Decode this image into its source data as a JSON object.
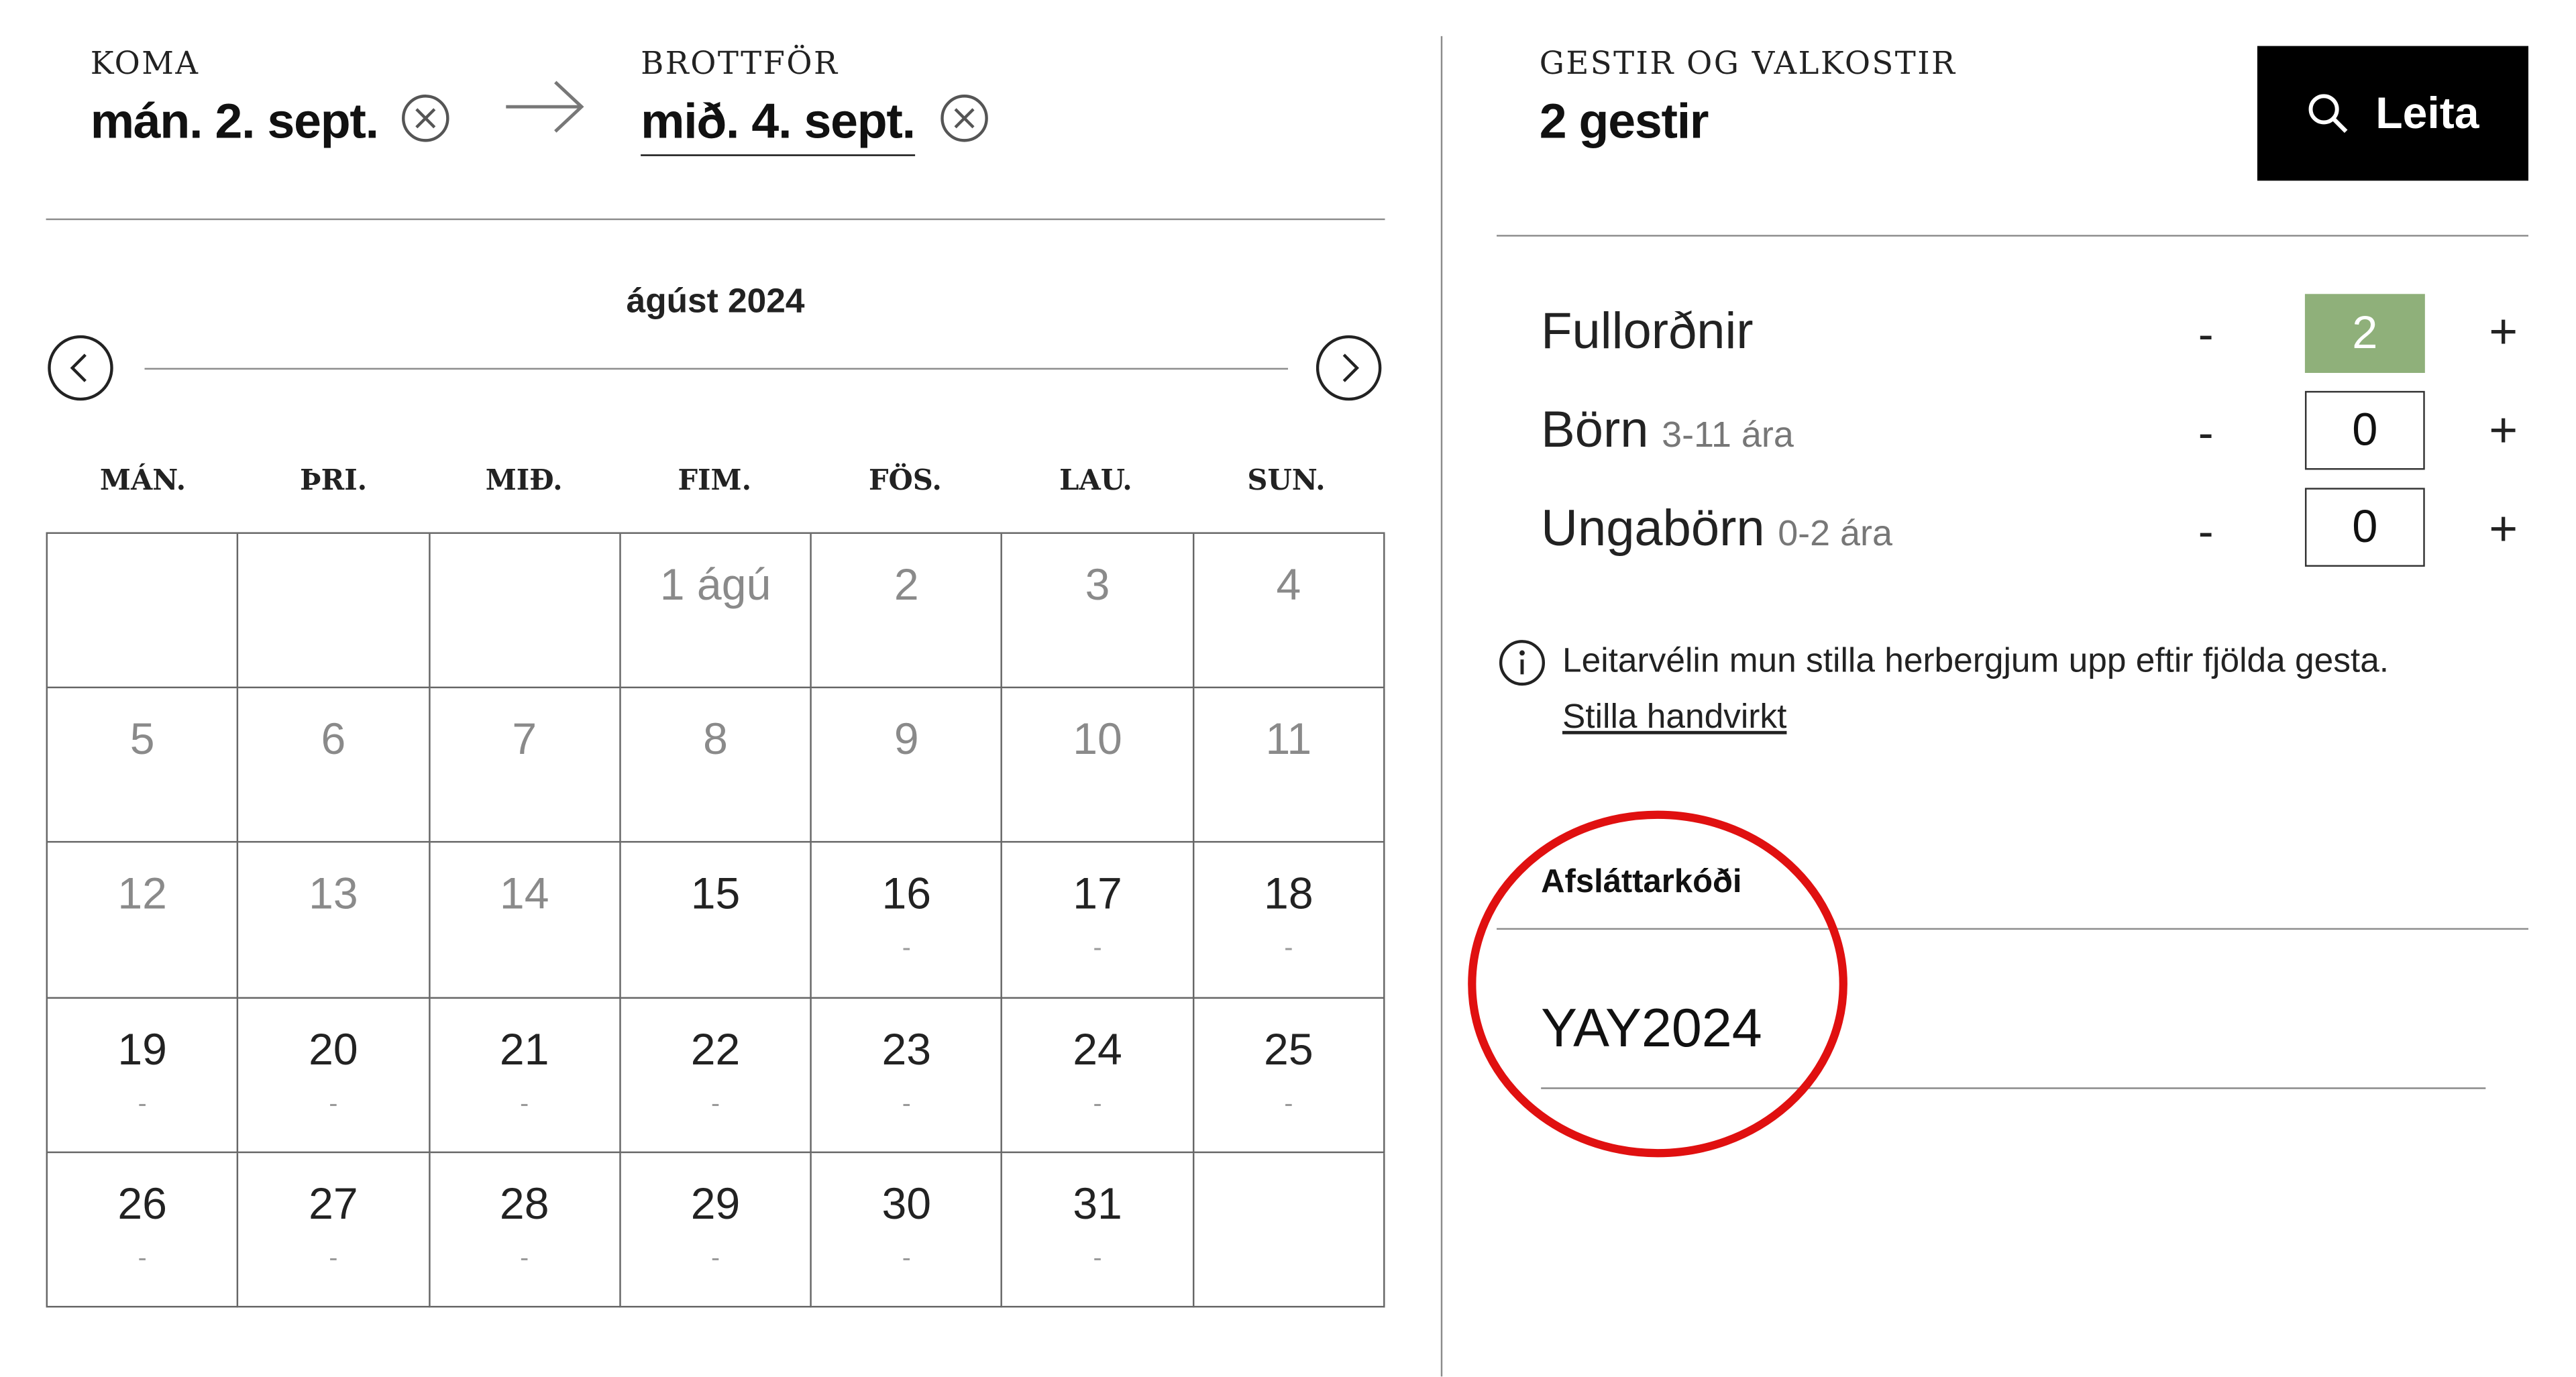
{
  "dates": {
    "arrival_label": "KOMA",
    "arrival_value": "mán. 2. sept.",
    "departure_label": "BROTTFÖR",
    "departure_value": "mið. 4. sept."
  },
  "calendar": {
    "month_title": "ágúst 2024",
    "weekdays": [
      "MÁN.",
      "ÞRI.",
      "MIÐ.",
      "FIM.",
      "FÖS.",
      "LAU.",
      "SUN."
    ],
    "cells": [
      {
        "day": "",
        "price": ""
      },
      {
        "day": "",
        "price": ""
      },
      {
        "day": "",
        "price": ""
      },
      {
        "day": "1 ágú",
        "price": "",
        "past": true
      },
      {
        "day": "2",
        "price": "",
        "past": true
      },
      {
        "day": "3",
        "price": "",
        "past": true
      },
      {
        "day": "4",
        "price": "",
        "past": true
      },
      {
        "day": "5",
        "price": "",
        "past": true
      },
      {
        "day": "6",
        "price": "",
        "past": true
      },
      {
        "day": "7",
        "price": "",
        "past": true
      },
      {
        "day": "8",
        "price": "",
        "past": true
      },
      {
        "day": "9",
        "price": "",
        "past": true
      },
      {
        "day": "10",
        "price": "",
        "past": true
      },
      {
        "day": "11",
        "price": "",
        "past": true
      },
      {
        "day": "12",
        "price": "",
        "past": true
      },
      {
        "day": "13",
        "price": "",
        "past": true
      },
      {
        "day": "14",
        "price": "",
        "past": true
      },
      {
        "day": "15",
        "price": ""
      },
      {
        "day": "16",
        "price": "-"
      },
      {
        "day": "17",
        "price": "-"
      },
      {
        "day": "18",
        "price": "-"
      },
      {
        "day": "19",
        "price": "-"
      },
      {
        "day": "20",
        "price": "-"
      },
      {
        "day": "21",
        "price": "-"
      },
      {
        "day": "22",
        "price": "-"
      },
      {
        "day": "23",
        "price": "-"
      },
      {
        "day": "24",
        "price": "-"
      },
      {
        "day": "25",
        "price": "-"
      },
      {
        "day": "26",
        "price": "-"
      },
      {
        "day": "27",
        "price": "-"
      },
      {
        "day": "28",
        "price": "-"
      },
      {
        "day": "29",
        "price": "-"
      },
      {
        "day": "30",
        "price": "-"
      },
      {
        "day": "31",
        "price": "-"
      },
      {
        "day": "",
        "price": ""
      }
    ]
  },
  "guests": {
    "label": "GESTIR OG VALKOSTIR",
    "summary": "2 gestir",
    "search_label": "Leita",
    "rows": [
      {
        "label": "Fullorðnir",
        "sub": "",
        "count": "2",
        "minus": "-",
        "plus": "+"
      },
      {
        "label": "Börn",
        "sub": "3-11 ára",
        "count": "0",
        "minus": "-",
        "plus": "+"
      },
      {
        "label": "Ungabörn",
        "sub": "0-2 ára",
        "count": "0",
        "minus": "-",
        "plus": "+"
      }
    ],
    "info_text": "Leitarvélin mun stilla herbergjum upp eftir fjölda gesta.",
    "manual_link": "Stilla handvirkt"
  },
  "promo": {
    "label": "Afsláttarkóði",
    "value": "YAY2024"
  },
  "colors": {
    "accent_green": "#8fb07a",
    "annotation_red": "#e01010",
    "button_black": "#000000"
  },
  "icons": {
    "clear": "circle-x-icon",
    "arrow": "arrow-right-icon",
    "prev": "chevron-left-circle-icon",
    "next": "chevron-right-circle-icon",
    "search": "search-icon",
    "info": "info-icon"
  }
}
